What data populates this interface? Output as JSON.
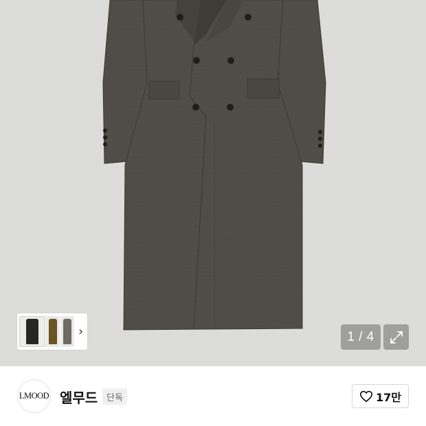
{
  "gallery": {
    "product_image_alt": "product-image",
    "counter": "1 / 4",
    "color_options": [
      "black",
      "brown",
      "gray"
    ],
    "colors": {
      "background": "#dcdcda",
      "coat": "#4d4a45"
    }
  },
  "brand": {
    "logo_text": "LMOOD",
    "name": "엘무드",
    "badge": "단독"
  },
  "like": {
    "count": "17만"
  }
}
